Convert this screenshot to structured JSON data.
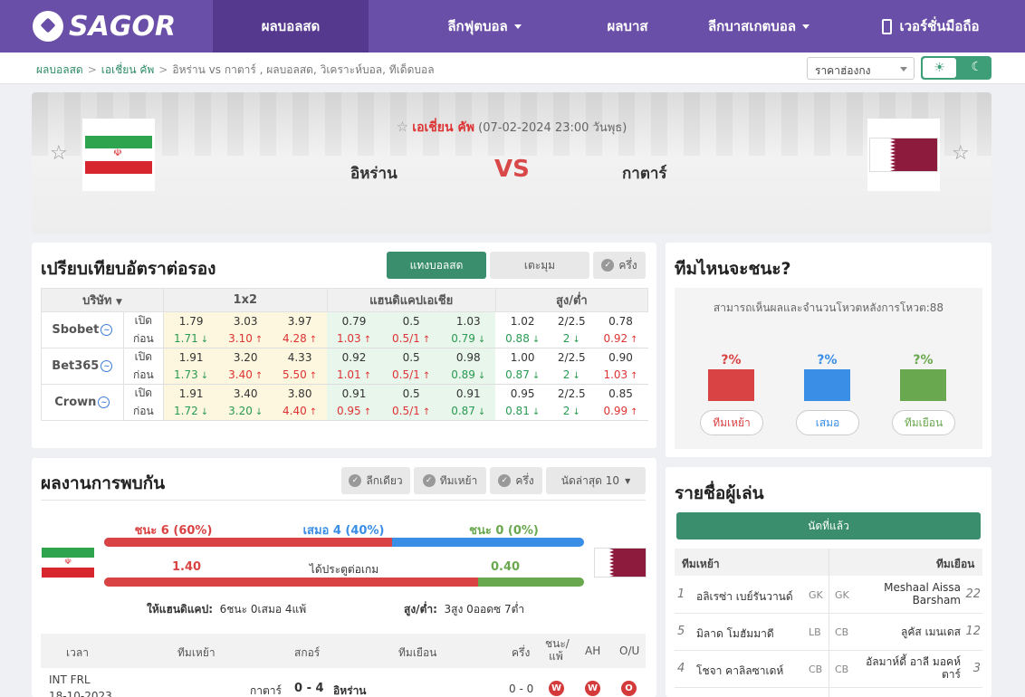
{
  "nav": {
    "logo": "SAGOR",
    "items": [
      "ผลบอลสด",
      "ลีกฟุตบอล",
      "ผลบาส",
      "ลีกบาสเกตบอล",
      "เวอร์ชั่นมือถือ"
    ]
  },
  "breadcrumb": {
    "home": "ผลบอลสด",
    "league": "เอเชี่ยน คัพ",
    "current": "อิหร่าน vs  กาตาร์ ,  ผลบอลสด,  วิเคราะห์บอล,  ทีเด็ดบอล"
  },
  "price_select": "ราคาฮ่องกง",
  "match": {
    "league": "เอเชี่ยน คัพ",
    "datetime": "(07-02-2024 23:00 วันพุธ)",
    "home": "อิหร่าน",
    "away": "กาตาร์",
    "vs": "VS"
  },
  "odds": {
    "title": "เปรียบเทียบอัตราต่อรอง",
    "tabs": [
      "แทงบอลสด",
      "เตะมุม",
      "ครึ่ง"
    ],
    "headers": {
      "company": "บริษัท",
      "x12": "1x2",
      "hdp": "แฮนดิแคปเอเชีย",
      "ou": "สูง/ต่ำ"
    },
    "open_label": "เปิด",
    "prev_label": "ก่อน",
    "rows": [
      {
        "company": "Sbobet",
        "open": [
          "1.79",
          "3.03",
          "3.97",
          "0.79",
          "0.5",
          "1.03",
          "1.02",
          "2/2.5",
          "0.78"
        ],
        "prev": [
          "1.71",
          "3.10",
          "4.28",
          "1.03",
          "0.5/1",
          "0.79",
          "0.88",
          "2",
          "0.92"
        ],
        "dir": [
          "dn",
          "up",
          "up",
          "up",
          "up",
          "dn",
          "dn",
          "dn",
          "up"
        ]
      },
      {
        "company": "Bet365",
        "open": [
          "1.91",
          "3.20",
          "4.33",
          "0.92",
          "0.5",
          "0.98",
          "1.00",
          "2/2.5",
          "0.90"
        ],
        "prev": [
          "1.73",
          "3.40",
          "5.50",
          "1.01",
          "0.5/1",
          "0.89",
          "0.87",
          "2",
          "1.03"
        ],
        "dir": [
          "dn",
          "up",
          "up",
          "up",
          "up",
          "dn",
          "dn",
          "dn",
          "up"
        ]
      },
      {
        "company": "Crown",
        "open": [
          "1.91",
          "3.40",
          "3.80",
          "0.91",
          "0.5",
          "0.91",
          "0.95",
          "2/2.5",
          "0.85"
        ],
        "prev": [
          "1.72",
          "3.20",
          "4.40",
          "0.95",
          "0.5/1",
          "0.87",
          "0.81",
          "2",
          "0.99"
        ],
        "dir": [
          "dn",
          "dn",
          "up",
          "up",
          "up",
          "dn",
          "dn",
          "dn",
          "up"
        ]
      }
    ]
  },
  "vote": {
    "title": "ทีมไหนจะชนะ?",
    "subtitle": "สามารถเห็นผลและจำนวนโหวตหลังการโหวต:88",
    "options": [
      {
        "pct": "?%",
        "label": "ทีมเหย้า",
        "color": "#d94343"
      },
      {
        "pct": "?%",
        "label": "เสมอ",
        "color": "#3a8ee6"
      },
      {
        "pct": "?%",
        "label": "ทีมเยือน",
        "color": "#6aa84f"
      }
    ]
  },
  "h2h": {
    "title": "ผลงานการพบกัน",
    "filters": [
      "ลีกเดียว",
      "ทีมเหย้า",
      "ครึ่ง"
    ],
    "recent": "นัดล่าสุด 10",
    "win": "ชนะ 6 (60%)",
    "draw": "เสมอ 4 (40%)",
    "loss": "ชนะ 0 (0%)",
    "win_share": 0.6,
    "draw_share": 0.4,
    "goals_home": "1.40",
    "goals_label": "ได้ประตูต่อเกม",
    "goals_away": "0.40",
    "goals_home_share": 0.78,
    "hdp_label": "ให้แฮนดิแคป:",
    "hdp_value": "6ชนะ 0เสมอ 4แพ้",
    "ou_label": "สูง/ต่ำ:",
    "ou_value": "3สูง 0ออดซ 7ต่ำ",
    "columns": [
      "เวลา",
      "ทีมเหย้า",
      "สกอร์",
      "ทีมเยือน",
      "ครึ่ง",
      "ชนะ/แพ้",
      "AH",
      "O/U"
    ],
    "rows": [
      {
        "league": "INT FRL",
        "date": "18-10-2023",
        "home": "กาตาร์",
        "score": "0 - 4",
        "away": "อิหร่าน",
        "half": "0 - 0",
        "wl": "W",
        "ah": "W",
        "ou": "O"
      }
    ]
  },
  "lineup": {
    "title": "รายชื่อผู้เล่น",
    "button": "นัดที่แล้ว",
    "home_header": "ทีมเหย้า",
    "away_header": "ทีมเยือน",
    "rows": [
      {
        "hn": "1",
        "hname": "อลิเรซ่า เบย์รันวานด์",
        "hpos": "GK",
        "apos": "GK",
        "aname": "Meshaal Aissa Barsham",
        "an": "22"
      },
      {
        "hn": "5",
        "hname": "มิลาด โมฮัมมาดี",
        "hpos": "LB",
        "apos": "CB",
        "aname": "ลูคัส เมนเดส",
        "an": "12"
      },
      {
        "hn": "4",
        "hname": "โชจา คาลิลซาเดห์",
        "hpos": "CB",
        "apos": "CB",
        "aname": "อัลมาห์ดี้ อาลี มอคห์ตาร์",
        "an": "3"
      }
    ]
  }
}
